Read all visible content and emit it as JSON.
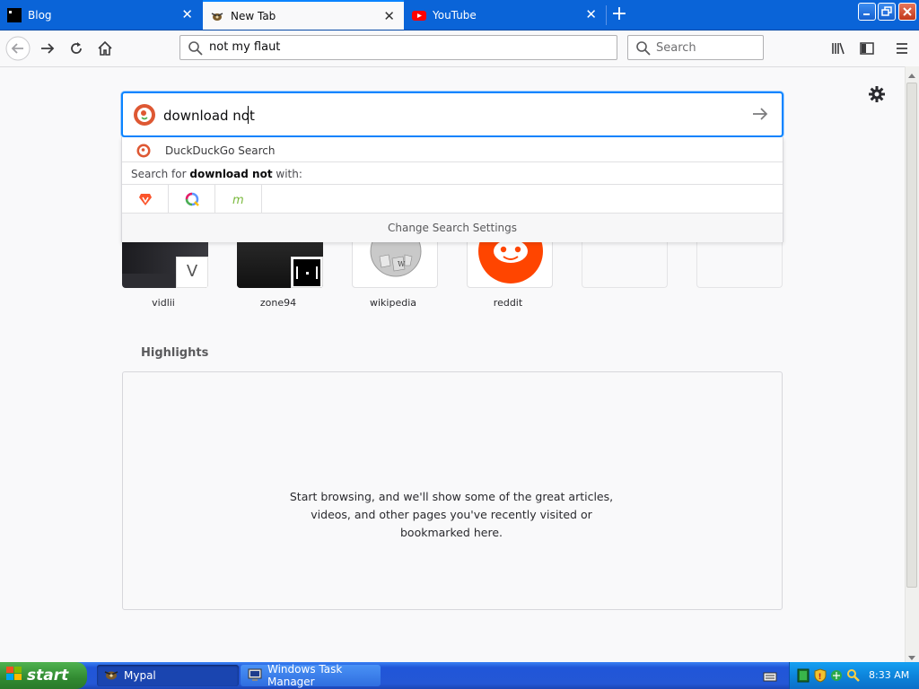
{
  "tabs": [
    {
      "title": "Blog",
      "icon": "terminal-icon",
      "active": false
    },
    {
      "title": "New Tab",
      "icon": "bug-icon",
      "active": true
    },
    {
      "title": "YouTube",
      "icon": "youtube-icon",
      "active": false
    }
  ],
  "urlbar": {
    "value": "not my flaut"
  },
  "searchbar": {
    "placeholder": "Search"
  },
  "search": {
    "query": "download not",
    "engine_label": "DuckDuckGo Search",
    "search_for_prefix": "Search for ",
    "search_for_query": "download not",
    "search_for_suffix": " with:",
    "alt_engines": [
      "brave-icon",
      "qwant-icon",
      "mojeek-icon"
    ],
    "change_settings": "Change Search Settings"
  },
  "top_sites": [
    {
      "label": "vidlii",
      "badge": "V"
    },
    {
      "label": "zone94"
    },
    {
      "label": "wikipedia"
    },
    {
      "label": "reddit"
    },
    {
      "label": ""
    },
    {
      "label": ""
    }
  ],
  "highlights": {
    "title": "Highlights",
    "empty_message": "Start browsing, and we'll show some of the great articles, videos, and other pages you've recently visited or bookmarked here."
  },
  "taskbar": {
    "start_label": "start",
    "buttons": [
      {
        "label": "Mypal",
        "active": true
      },
      {
        "label": "Windows Task Manager",
        "active": false
      }
    ],
    "clock": "8:33 AM"
  },
  "colors": {
    "accent": "#0a84ff",
    "tabstrip": "#0a64d8",
    "taskbar": "#2457d6",
    "start": "#3c9a3c"
  }
}
